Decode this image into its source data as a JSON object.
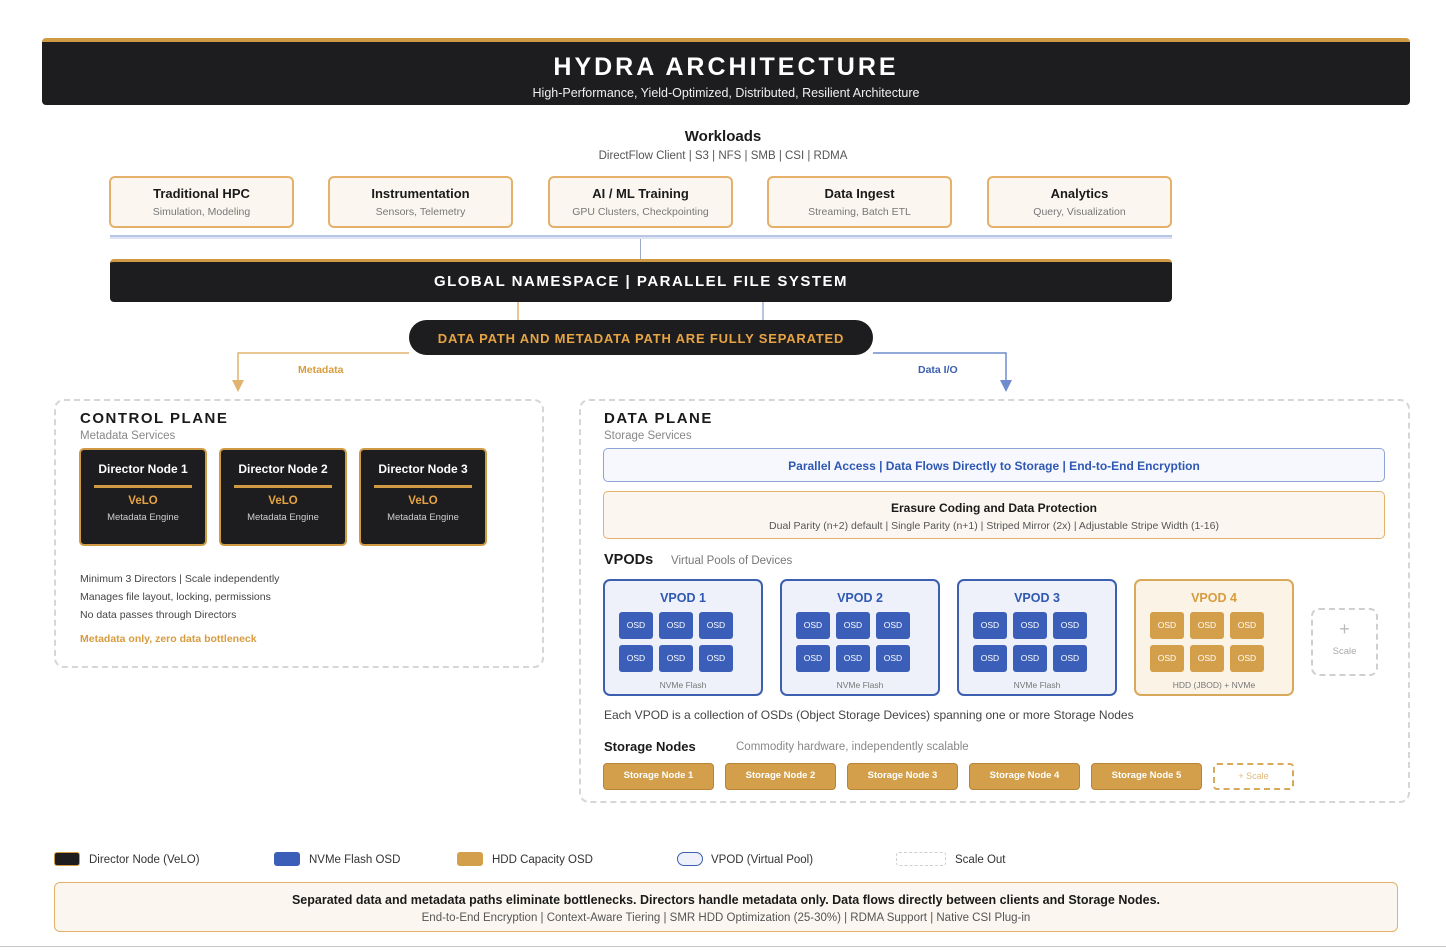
{
  "header": {
    "title": "HYDRA ARCHITECTURE",
    "subtitle": "High-Performance, Yield-Optimized, Distributed, Resilient Architecture"
  },
  "workloads": {
    "title": "Workloads",
    "protocols": "DirectFlow Client | S3 | NFS | SMB | CSI | RDMA",
    "items": [
      {
        "name": "Traditional HPC",
        "desc": "Simulation, Modeling"
      },
      {
        "name": "Instrumentation",
        "desc": "Sensors, Telemetry"
      },
      {
        "name": "AI / ML Training",
        "desc": "GPU Clusters, Checkpointing"
      },
      {
        "name": "Data Ingest",
        "desc": "Streaming, Batch ETL"
      },
      {
        "name": "Analytics",
        "desc": "Query, Visualization"
      }
    ]
  },
  "namespace": "GLOBAL NAMESPACE | PARALLEL FILE SYSTEM",
  "separation": "DATA PATH AND METADATA PATH ARE FULLY SEPARATED",
  "paths": {
    "metadata": "Metadata",
    "data": "Data I/O"
  },
  "control_plane": {
    "title": "CONTROL PLANE",
    "subtitle": "Metadata Services",
    "directors": [
      {
        "name": "Director Node 1",
        "engine": "VeLO",
        "engine_desc": "Metadata Engine"
      },
      {
        "name": "Director Node 2",
        "engine": "VeLO",
        "engine_desc": "Metadata Engine"
      },
      {
        "name": "Director Node 3",
        "engine": "VeLO",
        "engine_desc": "Metadata Engine"
      }
    ],
    "notes": [
      "Minimum 3 Directors | Scale independently",
      "Manages file layout, locking, permissions",
      "No data passes through Directors"
    ],
    "highlight": "Metadata only, zero data bottleneck"
  },
  "data_plane": {
    "title": "DATA PLANE",
    "subtitle": "Storage Services",
    "parallel_access": "Parallel Access | Data Flows Directly to Storage | End-to-End Encryption",
    "erasure": {
      "title": "Erasure Coding and Data Protection",
      "details": "Dual Parity (n+2) default | Single Parity (n+1) | Striped Mirror (2x) | Adjustable Stripe Width (1-16)"
    },
    "vpods_title": "VPODs",
    "vpods_subtitle": "Virtual Pools of Devices",
    "osd_label": "OSD",
    "vpods": [
      {
        "name": "VPOD 1",
        "media": "NVMe Flash"
      },
      {
        "name": "VPOD 2",
        "media": "NVMe Flash"
      },
      {
        "name": "VPOD 3",
        "media": "NVMe Flash"
      },
      {
        "name": "VPOD 4",
        "media": "HDD (JBOD) + NVMe"
      }
    ],
    "scale_plus": "+",
    "scale_label": "Scale",
    "vpod_note": "Each VPOD is a collection of OSDs (Object Storage Devices) spanning one or more Storage Nodes",
    "storage_nodes_title": "Storage Nodes",
    "storage_nodes_subtitle": "Commodity hardware, independently scalable",
    "storage_nodes": [
      "Storage Node 1",
      "Storage Node 2",
      "Storage Node 3",
      "Storage Node 4",
      "Storage Node 5"
    ],
    "storage_scale": "+ Scale"
  },
  "legend": [
    {
      "label": "Director Node (VeLO)"
    },
    {
      "label": "NVMe Flash OSD"
    },
    {
      "label": "HDD Capacity OSD"
    },
    {
      "label": "VPOD (Virtual Pool)"
    },
    {
      "label": "Scale Out"
    }
  ],
  "footer": {
    "title": "Separated data and metadata paths eliminate bottlenecks. Directors handle metadata only. Data flows directly between clients and Storage Nodes.",
    "features": "End-to-End Encryption | Context-Aware Tiering | SMR HDD Optimization (25-30%) | RDMA Support | Native CSI Plug-in"
  },
  "colors": {
    "dark": "#1d1d1f",
    "gold": "#d09a44",
    "flash_blue": "#3b5fb8",
    "hdd_gold": "#d39f4a"
  }
}
